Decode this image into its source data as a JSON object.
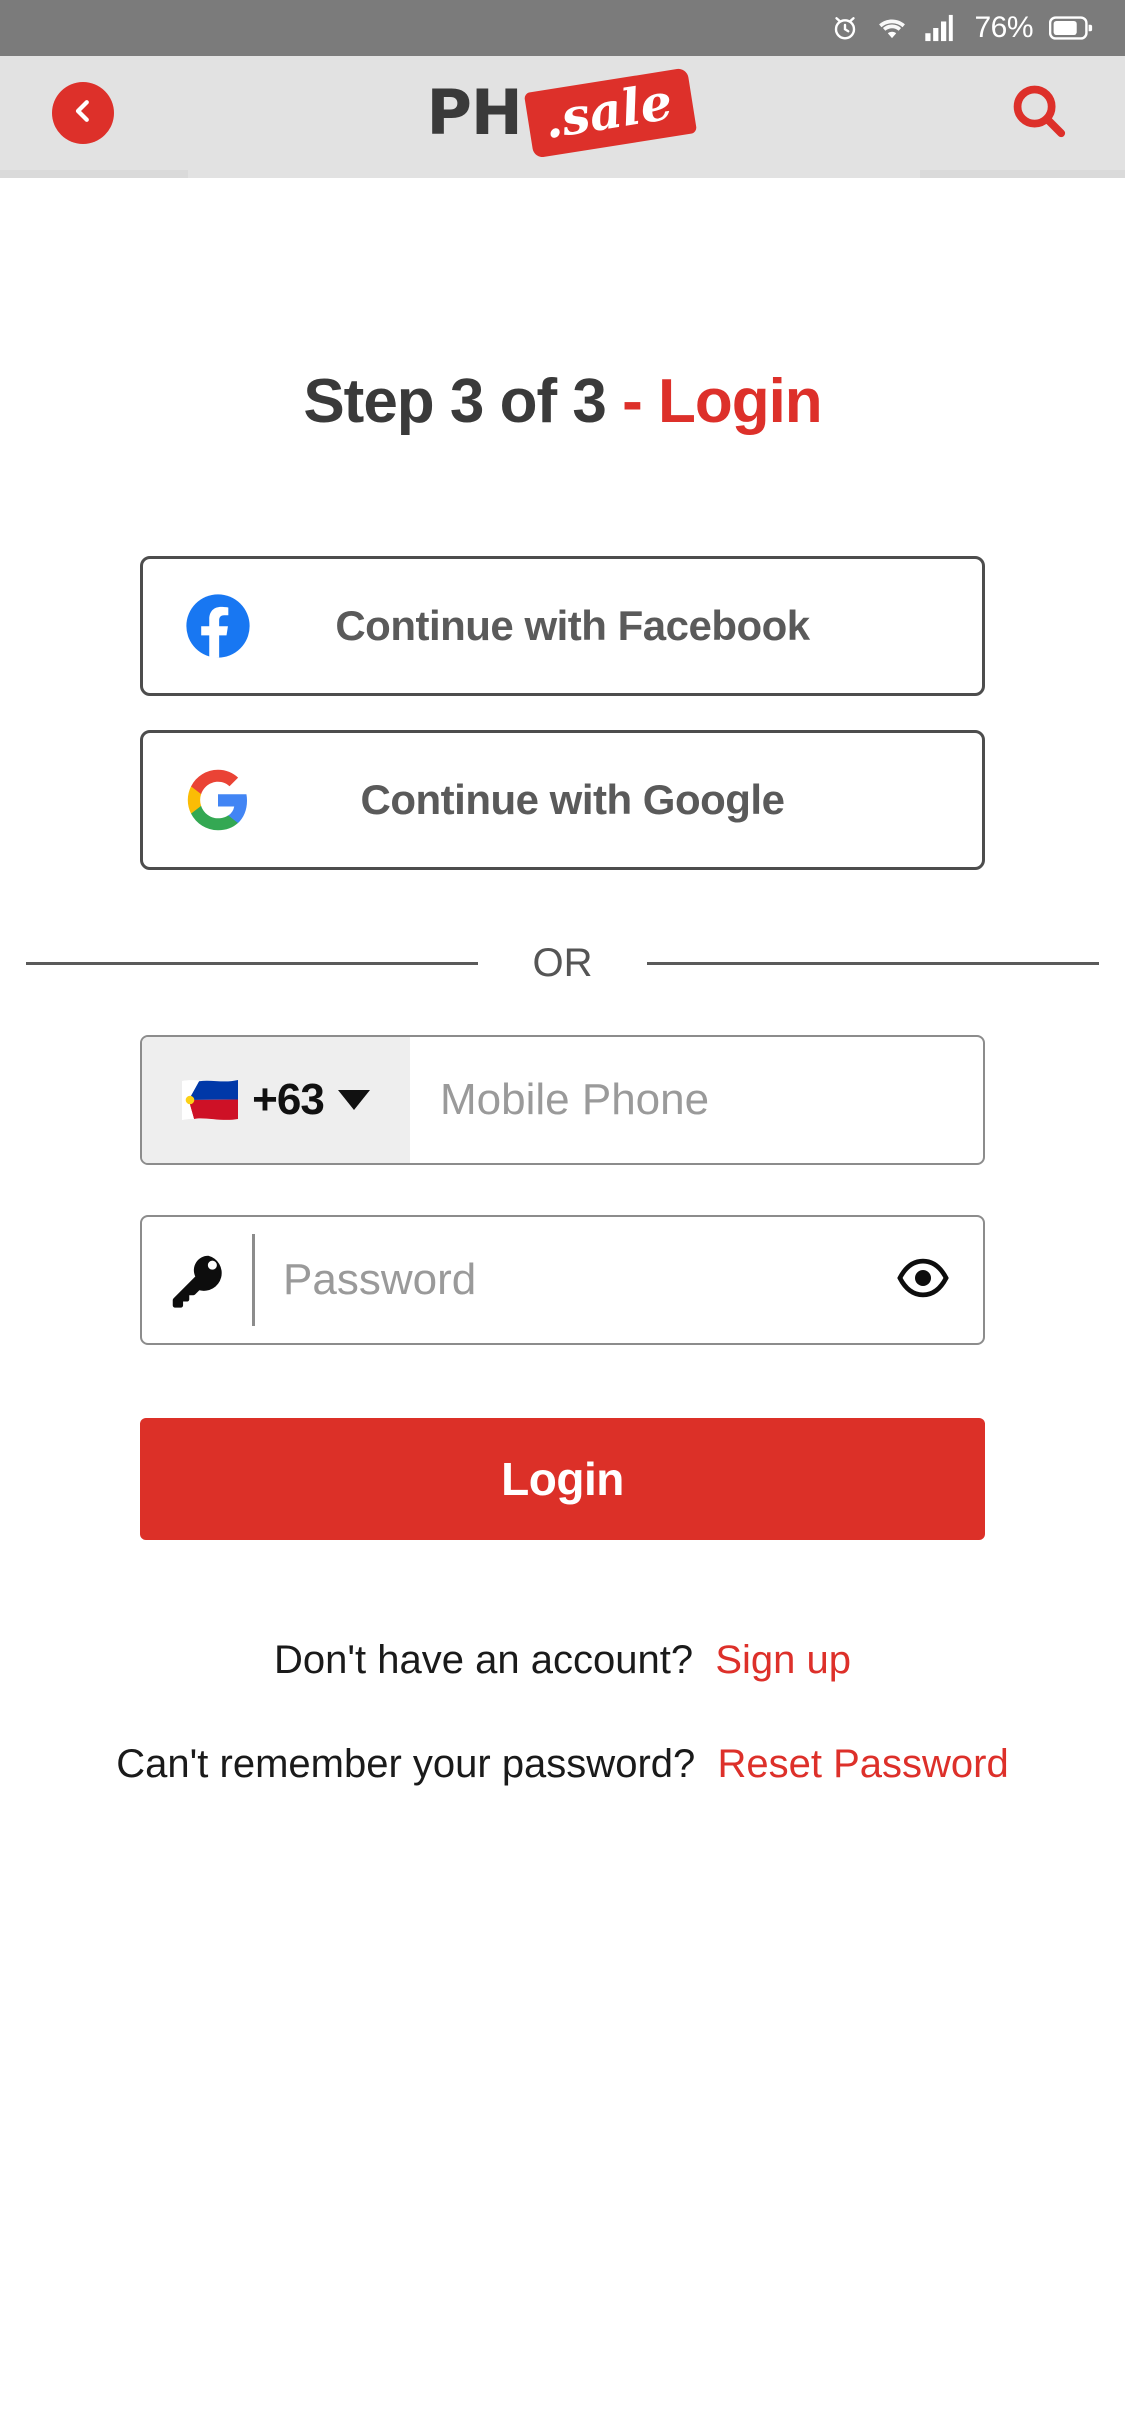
{
  "status_bar": {
    "alarm_icon": "alarm-clock-icon",
    "wifi_icon": "wifi-icon",
    "signal_icon": "cellular-signal-icon",
    "battery_percent": "76%",
    "battery_icon": "battery-icon",
    "background_color": "#7b7b7b"
  },
  "header": {
    "back_icon": "chevron-left-icon",
    "search_icon": "search-icon",
    "logo": {
      "primary_text": "PH",
      "tag_text": ".sale",
      "tag_color": "#dd302a",
      "primary_color": "#3a3a3a"
    },
    "background_color": "#e2e2e2"
  },
  "page": {
    "title_step": "Step 3 of 3",
    "title_dash": " - ",
    "title_mode": "Login",
    "step_color": "#3a3a3a",
    "accent_color": "#dd302a"
  },
  "social": {
    "facebook": {
      "label": "Continue with Facebook",
      "icon": "facebook-icon",
      "icon_color": "#1877f2"
    },
    "google": {
      "label": "Continue with Google",
      "icon": "google-icon"
    }
  },
  "divider": {
    "label": "OR"
  },
  "form": {
    "country_code": "+63",
    "country_flag": "philippines-flag-icon",
    "phone_placeholder": "Mobile Phone",
    "phone_value": "",
    "password_placeholder": "Password",
    "password_value": "",
    "key_icon": "key-icon",
    "eye_icon": "eye-icon",
    "caret_icon": "chevron-down-icon"
  },
  "login_button": {
    "label": "Login",
    "background_color": "#dc3028",
    "text_color": "#ffffff"
  },
  "footer": {
    "signup_prompt": "Don't have an account?",
    "signup_link": "Sign up",
    "reset_prompt": "Can't remember your password?",
    "reset_link": "Reset Password",
    "link_color": "#dd302a"
  }
}
